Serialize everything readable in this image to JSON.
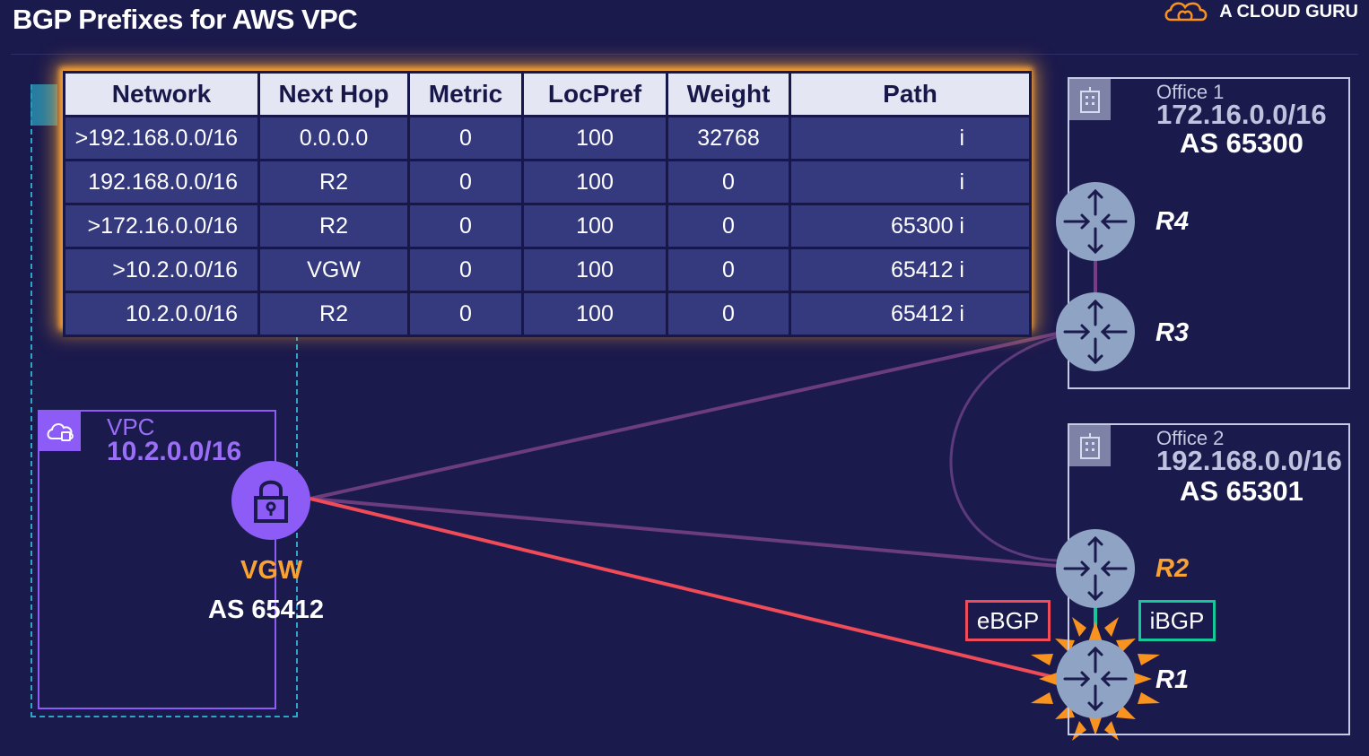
{
  "header": {
    "title": "BGP Prefixes for AWS VPC",
    "brand": "A CLOUD GURU"
  },
  "table": {
    "columns": [
      "Network",
      "Next Hop",
      "Metric",
      "LocPref",
      "Weight",
      "Path"
    ],
    "rows": [
      [
        ">192.168.0.0/16",
        "0.0.0.0",
        "0",
        "100",
        "32768",
        "i"
      ],
      [
        "192.168.0.0/16",
        "R2",
        "0",
        "100",
        "0",
        "i"
      ],
      [
        ">172.16.0.0/16",
        "R2",
        "0",
        "100",
        "0",
        "65300  i"
      ],
      [
        ">10.2.0.0/16",
        "VGW",
        "0",
        "100",
        "0",
        "65412  i"
      ],
      [
        "10.2.0.0/16",
        "R2",
        "0",
        "100",
        "0",
        "65412  i"
      ]
    ]
  },
  "office1": {
    "name": "Office 1",
    "cidr": "172.16.0.0/16",
    "as": "AS 65300"
  },
  "office2": {
    "name": "Office 2",
    "cidr": "192.168.0.0/16",
    "as": "AS 65301"
  },
  "vpc": {
    "name": "VPC",
    "cidr": "10.2.0.0/16"
  },
  "vgw": {
    "name": "VGW",
    "as": "AS 65412"
  },
  "routers": {
    "r4": "R4",
    "r3": "R3",
    "r2": "R2",
    "r1": "R1"
  },
  "session_tags": {
    "ebgp": "eBGP",
    "ibgp": "iBGP"
  },
  "colors": {
    "background": "#1b1a4d",
    "highlight": "#f7a233",
    "ebgp": "#ef4b58",
    "ibgp": "#16c79a",
    "vpc": "#8d5cf6",
    "router": "#8fa3c4"
  }
}
